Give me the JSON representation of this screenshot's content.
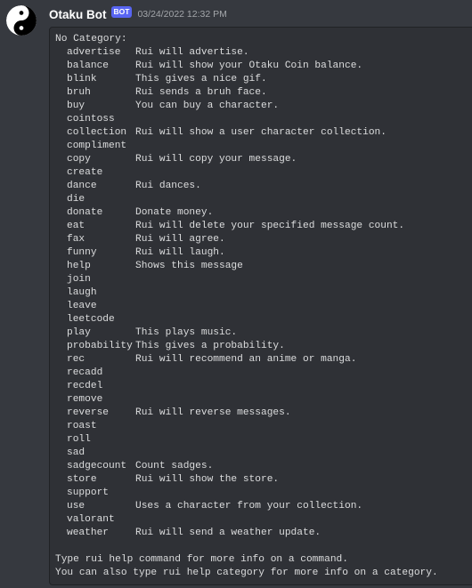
{
  "message": {
    "username": "Otaku Bot",
    "bot_tag": "BOT",
    "timestamp": "03/24/2022 12:32 PM",
    "avatar_icon": "yin-yang-icon"
  },
  "help": {
    "category_header": "No Category:",
    "commands": [
      {
        "name": "advertise",
        "description": "Rui will advertise."
      },
      {
        "name": "balance",
        "description": "Rui will show your Otaku Coin balance."
      },
      {
        "name": "blink",
        "description": "This gives a nice gif."
      },
      {
        "name": "bruh",
        "description": "Rui sends a bruh face."
      },
      {
        "name": "buy",
        "description": "You can buy a character."
      },
      {
        "name": "cointoss",
        "description": ""
      },
      {
        "name": "collection",
        "description": "Rui will show a user character collection."
      },
      {
        "name": "compliment",
        "description": ""
      },
      {
        "name": "copy",
        "description": "Rui will copy your message."
      },
      {
        "name": "create",
        "description": ""
      },
      {
        "name": "dance",
        "description": "Rui dances."
      },
      {
        "name": "die",
        "description": ""
      },
      {
        "name": "donate",
        "description": "Donate money."
      },
      {
        "name": "eat",
        "description": "Rui will delete your specified message count."
      },
      {
        "name": "fax",
        "description": "Rui will agree."
      },
      {
        "name": "funny",
        "description": "Rui will laugh."
      },
      {
        "name": "help",
        "description": "Shows this message"
      },
      {
        "name": "join",
        "description": ""
      },
      {
        "name": "laugh",
        "description": ""
      },
      {
        "name": "leave",
        "description": ""
      },
      {
        "name": "leetcode",
        "description": ""
      },
      {
        "name": "play",
        "description": "This plays music."
      },
      {
        "name": "probability",
        "description": "This gives a probability."
      },
      {
        "name": "rec",
        "description": "Rui will recommend an anime or manga."
      },
      {
        "name": "recadd",
        "description": ""
      },
      {
        "name": "recdel",
        "description": ""
      },
      {
        "name": "remove",
        "description": ""
      },
      {
        "name": "reverse",
        "description": "Rui will reverse messages."
      },
      {
        "name": "roast",
        "description": ""
      },
      {
        "name": "roll",
        "description": ""
      },
      {
        "name": "sad",
        "description": ""
      },
      {
        "name": "sadgecount",
        "description": "Count sadges."
      },
      {
        "name": "store",
        "description": "Rui will show the store."
      },
      {
        "name": "support",
        "description": ""
      },
      {
        "name": "use",
        "description": "Uses a character from your collection."
      },
      {
        "name": "valorant",
        "description": ""
      },
      {
        "name": "weather",
        "description": "Rui will send a weather update."
      }
    ],
    "footer_line_1": "Type rui help command for more info on a command.",
    "footer_line_2": "You can also type rui help category for more info on a category."
  },
  "colors": {
    "background": "#36393f",
    "codeblock_background": "#2f3136",
    "bot_tag": "#5865f2",
    "text": "#dcddde",
    "timestamp": "#a3a6aa"
  }
}
